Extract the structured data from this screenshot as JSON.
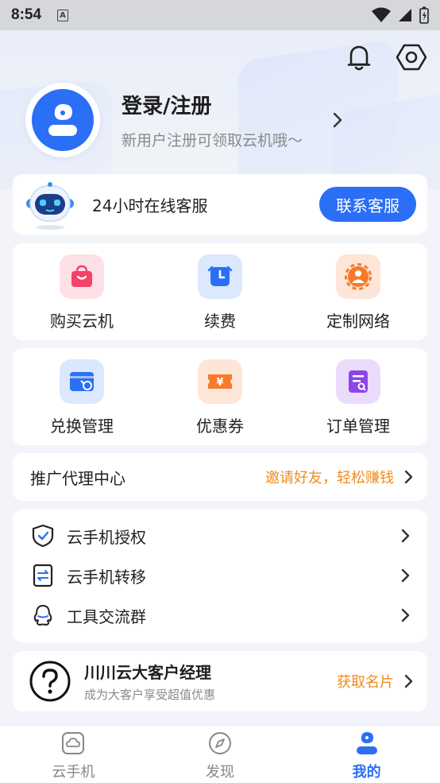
{
  "status_bar": {
    "time": "8:54",
    "badge": "A"
  },
  "profile": {
    "title": "登录/注册",
    "subtitle": "新用户注册可领取云机哦～"
  },
  "service": {
    "label": "24小时在线客服",
    "button": "联系客服"
  },
  "grid1": [
    {
      "label": "购买云机",
      "icon": "shopping-bag-icon",
      "color": "#f4426a"
    },
    {
      "label": "续费",
      "icon": "clock-icon",
      "color": "#2a6ff5"
    },
    {
      "label": "定制网络",
      "icon": "network-icon",
      "color": "#f57a2a"
    }
  ],
  "grid2": [
    {
      "label": "兑换管理",
      "icon": "redeem-card-icon",
      "color": "#2a6ff5"
    },
    {
      "label": "优惠券",
      "icon": "coupon-icon",
      "color": "#f57a2a"
    },
    {
      "label": "订单管理",
      "icon": "order-icon",
      "color": "#8b45e8"
    }
  ],
  "promo": {
    "left": "推广代理中心",
    "right": "邀请好友，轻松赚钱"
  },
  "menu": [
    {
      "label": "云手机授权",
      "icon": "shield-check-icon"
    },
    {
      "label": "云手机转移",
      "icon": "transfer-icon"
    },
    {
      "label": "工具交流群",
      "icon": "qq-group-icon"
    }
  ],
  "manager": {
    "title": "川川云大客户经理",
    "subtitle": "成为大客户享受超值优惠",
    "action": "获取名片"
  },
  "bottom_nav": [
    {
      "label": "云手机",
      "active": false
    },
    {
      "label": "发现",
      "active": false
    },
    {
      "label": "我的",
      "active": true
    }
  ],
  "colors": {
    "accent": "#2a6ff5",
    "orange": "#f08c1d"
  }
}
